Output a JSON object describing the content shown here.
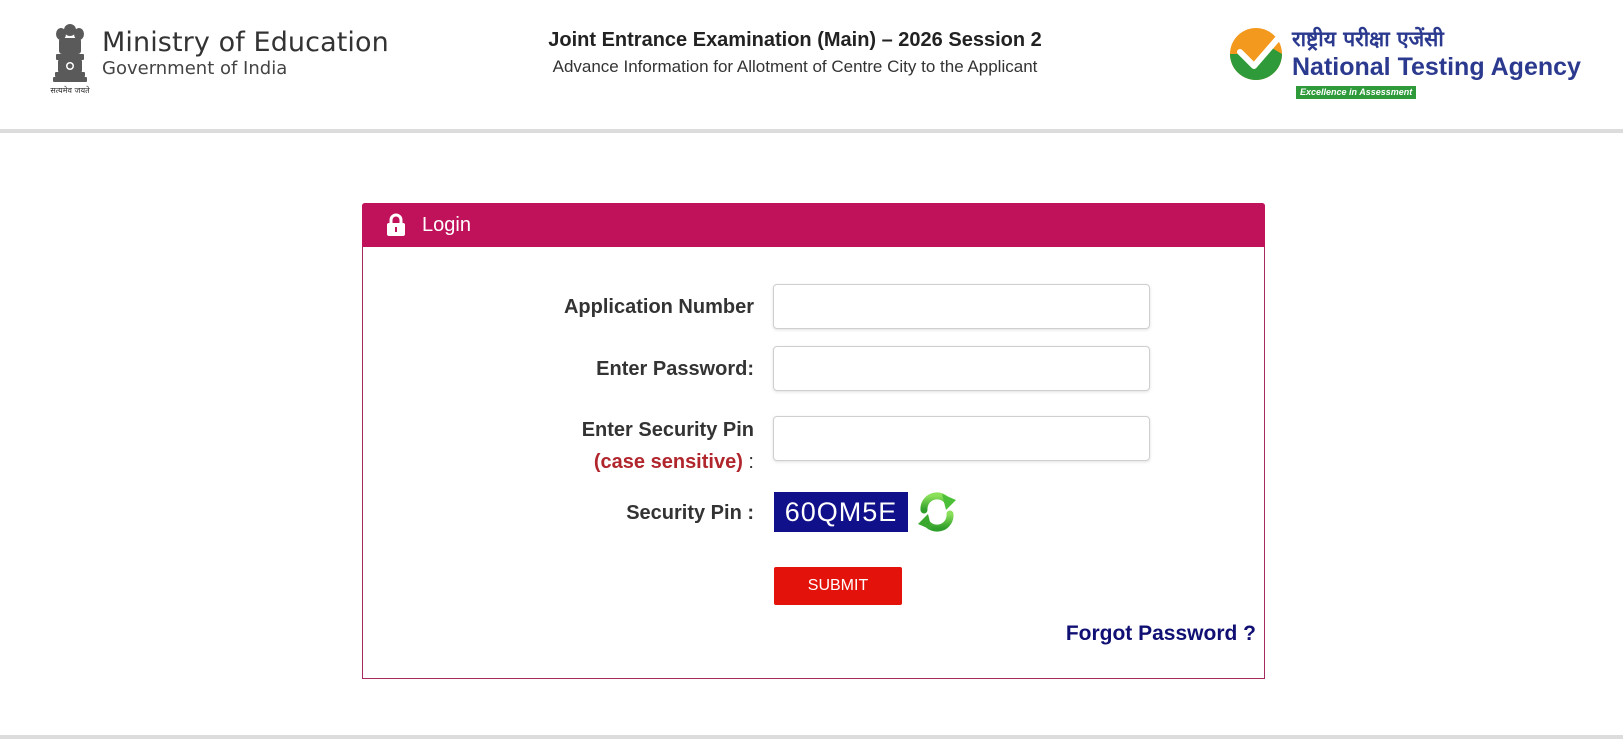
{
  "header": {
    "ministry_title": "Ministry of Education",
    "ministry_sub": "Government of India",
    "emblem_caption": "सत्यमेव जयते",
    "exam_title": "Joint Entrance Examination (Main) – 2026 Session 2",
    "exam_subtitle": "Advance Information for Allotment of Centre City to the Applicant",
    "nta_hindi": "राष्ट्रीय परीक्षा एजेंसी",
    "nta_english": "National Testing Agency",
    "nta_tagline": "Excellence in Assessment"
  },
  "login": {
    "title": "Login",
    "application_number_label": "Application Number",
    "application_number_value": "",
    "password_label": "Enter Password:",
    "password_value": "",
    "security_pin_label": "Enter Security Pin",
    "case_sensitive_note": "(case sensitive)",
    "colon": " :",
    "security_pin_value": "",
    "captcha_label": "Security Pin :",
    "captcha_value": "60QM5E",
    "submit_label": "SUBMIT",
    "forgot_password_label": "Forgot Password ?"
  },
  "colors": {
    "panel_header": "#c0125a",
    "submit": "#e3120b",
    "captcha_bg": "#10108a",
    "link": "#101074",
    "nta_blue": "#2b3a8f"
  }
}
